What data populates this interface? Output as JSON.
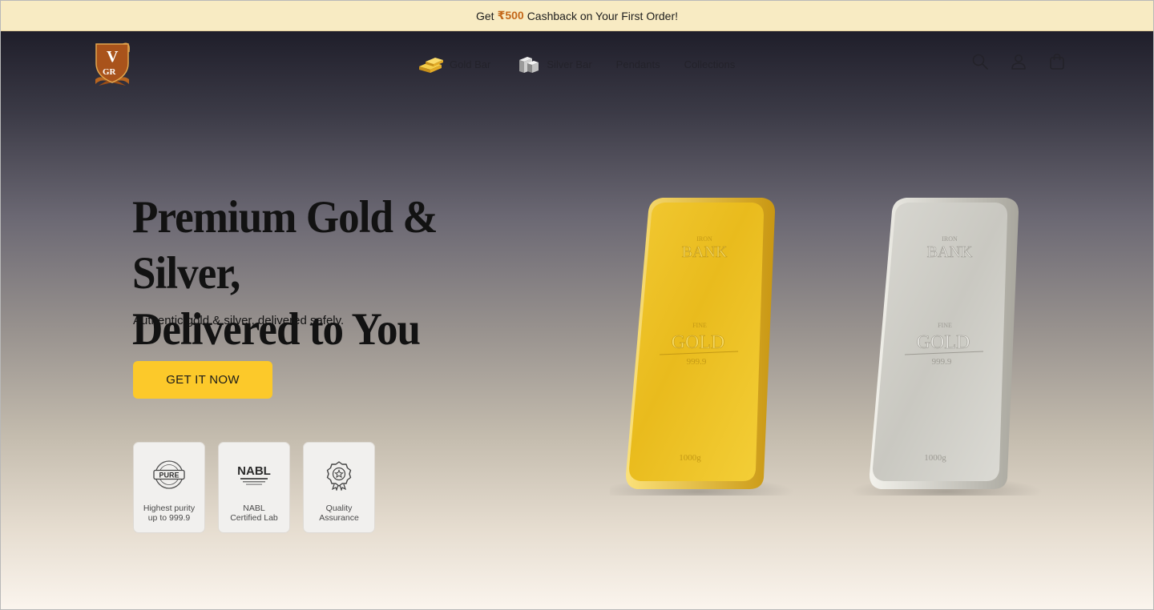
{
  "announcement": {
    "prefix": "Get",
    "amount": "₹500",
    "suffix": "Cashback on Your First Order!"
  },
  "header": {
    "logo": {
      "letters_top": "V",
      "letters_bottom": "GR"
    },
    "nav": [
      {
        "label": "Gold Bar",
        "icon": "gold-bar-icon"
      },
      {
        "label": "Silver Bar",
        "icon": "silver-bar-icon"
      },
      {
        "label": "Pendants"
      },
      {
        "label": "Collections"
      }
    ],
    "icons": [
      "search-icon",
      "account-icon",
      "cart-icon"
    ]
  },
  "hero": {
    "title_line1": "Premium Gold & Silver,",
    "title_line2": "Delivered to You",
    "subtitle": "Authentic gold & silver, delivered safely.",
    "cta": "GET IT NOW",
    "badges": [
      {
        "icon": "pure-seal-icon",
        "icon_text": "PURE",
        "line1": "Highest purity",
        "line2": "up to 999.9"
      },
      {
        "icon": "nabl-logo-icon",
        "icon_text": "NABL",
        "line1": "NABL",
        "line2": "Certified Lab"
      },
      {
        "icon": "quality-rosette-icon",
        "line1": "Quality",
        "line2": "Assurance"
      }
    ],
    "products": [
      {
        "name": "gold-bar",
        "bank": "BANK",
        "metal": "GOLD",
        "fineness": "999.9",
        "weight": "1000g"
      },
      {
        "name": "silver-bar",
        "bank": "BANK",
        "metal": "GOLD",
        "fineness": "999.9",
        "weight": "1000g"
      }
    ]
  },
  "colors": {
    "announcement_bg": "#f8ebc3",
    "cashback_accent": "#c4681a",
    "cta_bg": "#fcc92a",
    "logo_brown": "#a9531b",
    "gold": "#f2c21b",
    "silver": "#d6d5cf"
  }
}
